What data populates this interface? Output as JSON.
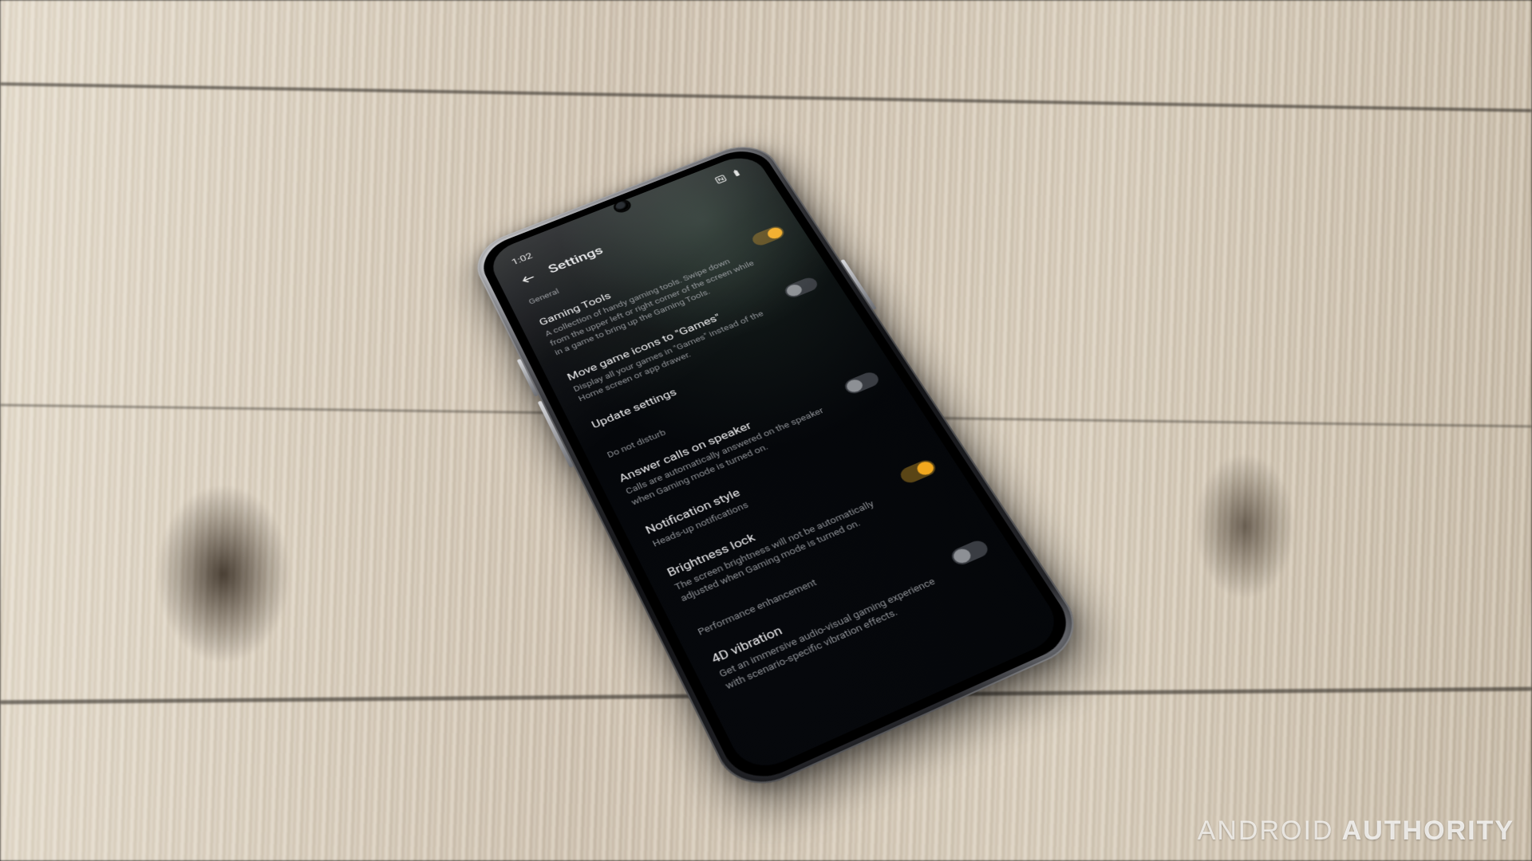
{
  "watermark_part1": "ANDROID",
  "watermark_part2": "AUTHORITY",
  "colors": {
    "accent": "#f2a81e"
  },
  "status": {
    "time": "1:02",
    "icons": [
      "nfc",
      "battery"
    ]
  },
  "header": {
    "title": "Settings"
  },
  "sections": [
    {
      "label": "General",
      "items": [
        {
          "title": "Gaming Tools",
          "sub": "A collection of handy gaming tools. Swipe down from the upper left or right corner of the screen while in a game to bring up the Gaming Tools.",
          "toggle": "on"
        },
        {
          "title": "Move game icons to \"Games\"",
          "sub": "Display all your games in \"Games\" instead of the Home screen or app drawer.",
          "toggle": "off"
        },
        {
          "title": "Update settings",
          "sub": "",
          "toggle": null
        }
      ]
    },
    {
      "label": "Do not disturb",
      "items": [
        {
          "title": "Answer calls on speaker",
          "sub": "Calls are automatically answered on the speaker when Gaming mode is turned on.",
          "toggle": "off"
        },
        {
          "title": "Notification style",
          "sub": "Heads-up notifications",
          "toggle": null
        },
        {
          "title": "Brightness lock",
          "sub": "The screen brightness will not be automatically adjusted when Gaming mode is turned on.",
          "toggle": "on"
        }
      ]
    },
    {
      "label": "Performance enhancement",
      "items": [
        {
          "title": "4D vibration",
          "sub": "Get an immersive audio-visual gaming experience with scenario-specific vibration effects.",
          "toggle": "off"
        }
      ]
    }
  ]
}
